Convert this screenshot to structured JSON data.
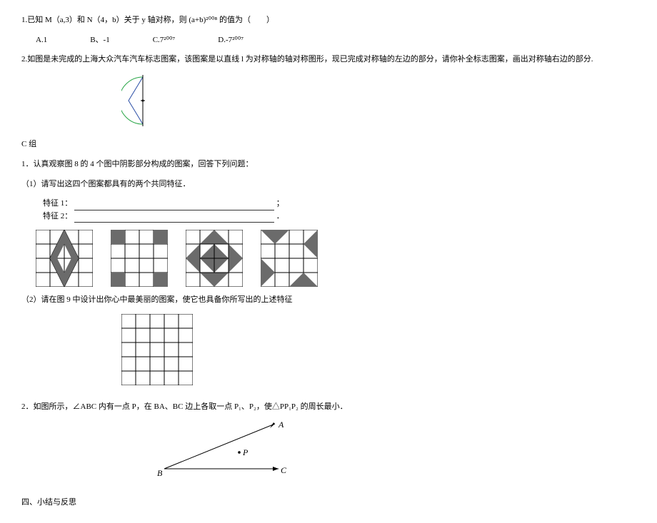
{
  "q1": {
    "text": "1.已知 M（a,3）和 N（4，b）关于 y 轴对称，则 (a+b)²⁰⁰⁸ 的值为（　　）",
    "options": {
      "a": "A.1",
      "b": "B、-1",
      "c": "C.7²⁰⁰⁷",
      "d": "D.-7²⁰⁰⁷"
    }
  },
  "q2": {
    "text": "2.如图是未完成的上海大众汽车汽车标志图案，该图案是以直线 l 为对称轴的轴对称图形，现已完成对称轴的左边的部分，请你补全标志图案，画出对称轴右边的部分."
  },
  "groupC": {
    "title": "C 组",
    "q1": {
      "text": "1．认真观察图 8 的 4 个图中阴影部分构成的图案，回答下列问题：",
      "sub1": "（1）请写出这四个图案都具有的两个共同特征．",
      "feat1_label": "特征 1：",
      "feat1_suffix": "；",
      "feat2_label": "特征 2：",
      "feat2_suffix": "．",
      "sub2": "（2）请在图 9 中设计出你心中最美丽的图案，使它也具备你所写出的上述特征"
    },
    "q2": {
      "text": "2．如图所示，∠ABC 内有一点 P，在 BA、BC 边上各取一点 P₁、P₂，使△PP₁P₂ 的周长最小．"
    }
  },
  "section4": "四、小结与反思",
  "angle": {
    "A": "A",
    "B": "B",
    "C": "C",
    "P": "P"
  }
}
